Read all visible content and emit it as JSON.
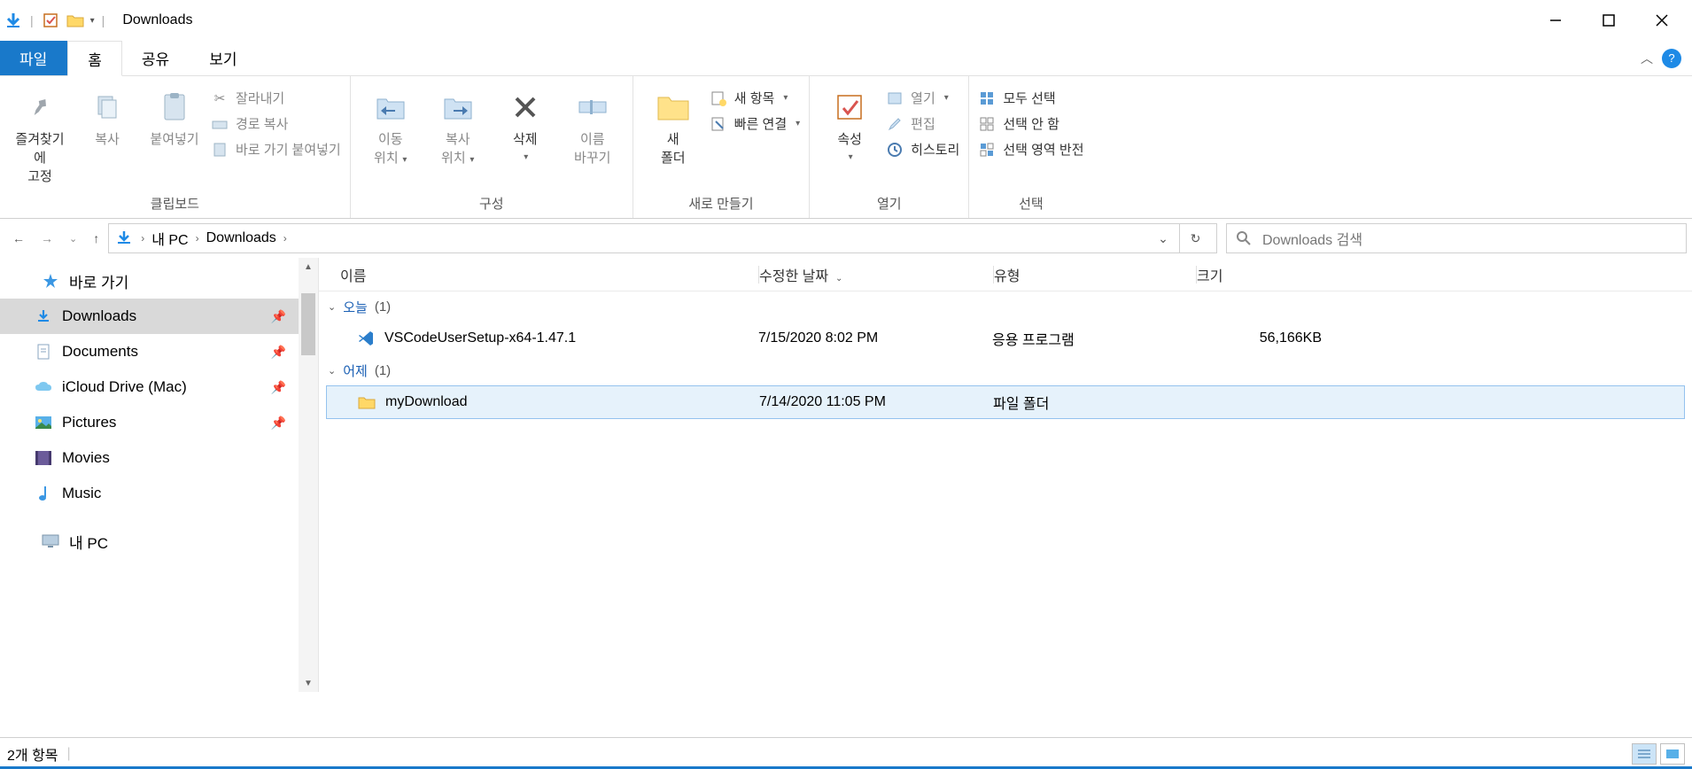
{
  "window": {
    "title": "Downloads"
  },
  "tabs": {
    "file": "파일",
    "home": "홈",
    "share": "공유",
    "view": "보기"
  },
  "ribbon": {
    "clipboard": {
      "title": "클립보드",
      "pin": "즐겨찾기에\n고정",
      "copy": "복사",
      "paste": "붙여넣기",
      "cut": "잘라내기",
      "copy_path": "경로 복사",
      "paste_shortcut": "바로 가기 붙여넣기"
    },
    "organize": {
      "title": "구성",
      "move": "이동\n위치",
      "copy_to": "복사\n위치",
      "delete": "삭제",
      "rename": "이름\n바꾸기"
    },
    "new": {
      "title": "새로 만들기",
      "new_folder": "새\n폴더",
      "new_item": "새 항목",
      "easy_access": "빠른 연결"
    },
    "open": {
      "title": "열기",
      "properties": "속성",
      "open": "열기",
      "edit": "편집",
      "history": "히스토리"
    },
    "select": {
      "title": "선택",
      "select_all": "모두 선택",
      "select_none": "선택 안 함",
      "invert": "선택 영역 반전"
    }
  },
  "address": {
    "root": "내 PC",
    "current": "Downloads"
  },
  "search": {
    "placeholder": "Downloads 검색"
  },
  "nav": {
    "quick_access": "바로 가기",
    "downloads": "Downloads",
    "documents": "Documents",
    "icloud": "iCloud Drive (Mac)",
    "pictures": "Pictures",
    "movies": "Movies",
    "music": "Music",
    "this_pc": "내 PC"
  },
  "columns": {
    "name": "이름",
    "date": "수정한 날짜",
    "type": "유형",
    "size": "크기"
  },
  "groups": {
    "today": {
      "label": "오늘",
      "count": "(1)"
    },
    "yesterday": {
      "label": "어제",
      "count": "(1)"
    }
  },
  "files": {
    "vscode": {
      "name": "VSCodeUserSetup-x64-1.47.1",
      "date": "7/15/2020 8:02 PM",
      "type": "응용 프로그램",
      "size": "56,166KB"
    },
    "mydownload": {
      "name": "myDownload",
      "date": "7/14/2020 11:05 PM",
      "type": "파일 폴더",
      "size": ""
    }
  },
  "status": {
    "items": "2개 항목"
  }
}
